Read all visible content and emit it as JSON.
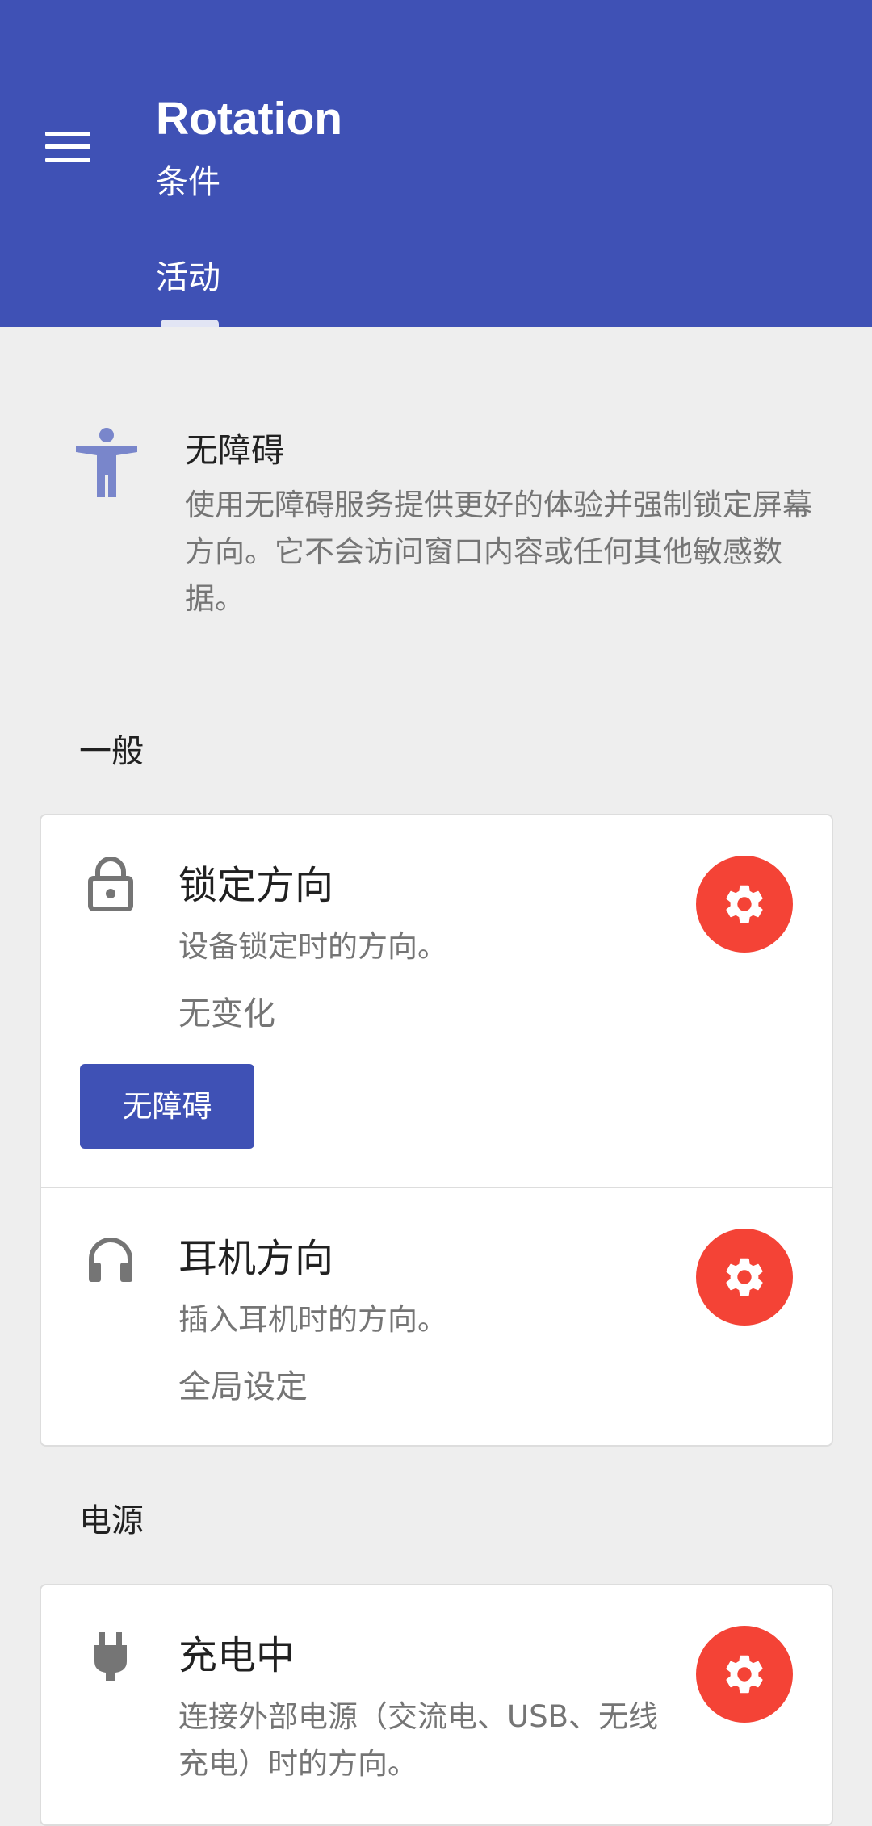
{
  "app": {
    "title": "Rotation",
    "subtitle": "条件",
    "tabs": [
      {
        "label": "活动"
      }
    ],
    "colors": {
      "primary": "#3F51B5",
      "accent": "#F44336",
      "background": "#EEEEEE"
    }
  },
  "info": {
    "icon": "accessibility-icon",
    "title": "无障碍",
    "description": "使用无障碍服务提供更好的体验并强制锁定屏幕方向。它不会访问窗口内容或任何其他敏感数据。"
  },
  "sections": [
    {
      "header": "一般",
      "items": [
        {
          "icon": "lock-icon",
          "title": "锁定方向",
          "description": "设备锁定时的方向。",
          "value": "无变化",
          "button": "无障碍"
        },
        {
          "icon": "headphones-icon",
          "title": "耳机方向",
          "description": "插入耳机时的方向。",
          "value": "全局设定"
        }
      ]
    },
    {
      "header": "电源",
      "items": [
        {
          "icon": "power-plug-icon",
          "title": "充电中",
          "description": "连接外部电源（交流电、USB、无线充电）时的方向。"
        }
      ]
    }
  ]
}
